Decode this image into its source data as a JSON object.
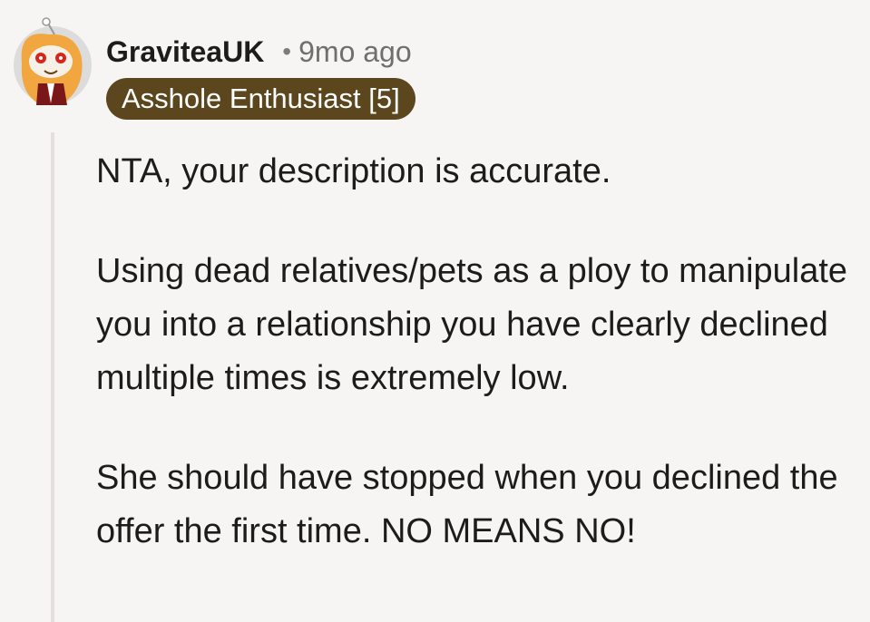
{
  "comment": {
    "author": "GraviteaUK",
    "separator": "•",
    "timestamp": "9mo ago",
    "flair": {
      "text": "Asshole Enthusiast [5]",
      "background": "#5c461e",
      "color": "#ffffff"
    },
    "avatar_icon": "snoo-avatar-icon",
    "paragraphs": [
      "NTA, your description is accurate.",
      "Using dead relatives/pets as a ploy to manipulate you into a relationship you have clearly declined multiple times is extremely low.",
      "She should have stopped when you declined the offer the first time. NO MEANS NO!"
    ]
  },
  "colors": {
    "page_background": "#f7f5f3",
    "text": "#1c1c1c",
    "muted_text": "#6f6f6f",
    "thread_line": "#e3dfda"
  }
}
